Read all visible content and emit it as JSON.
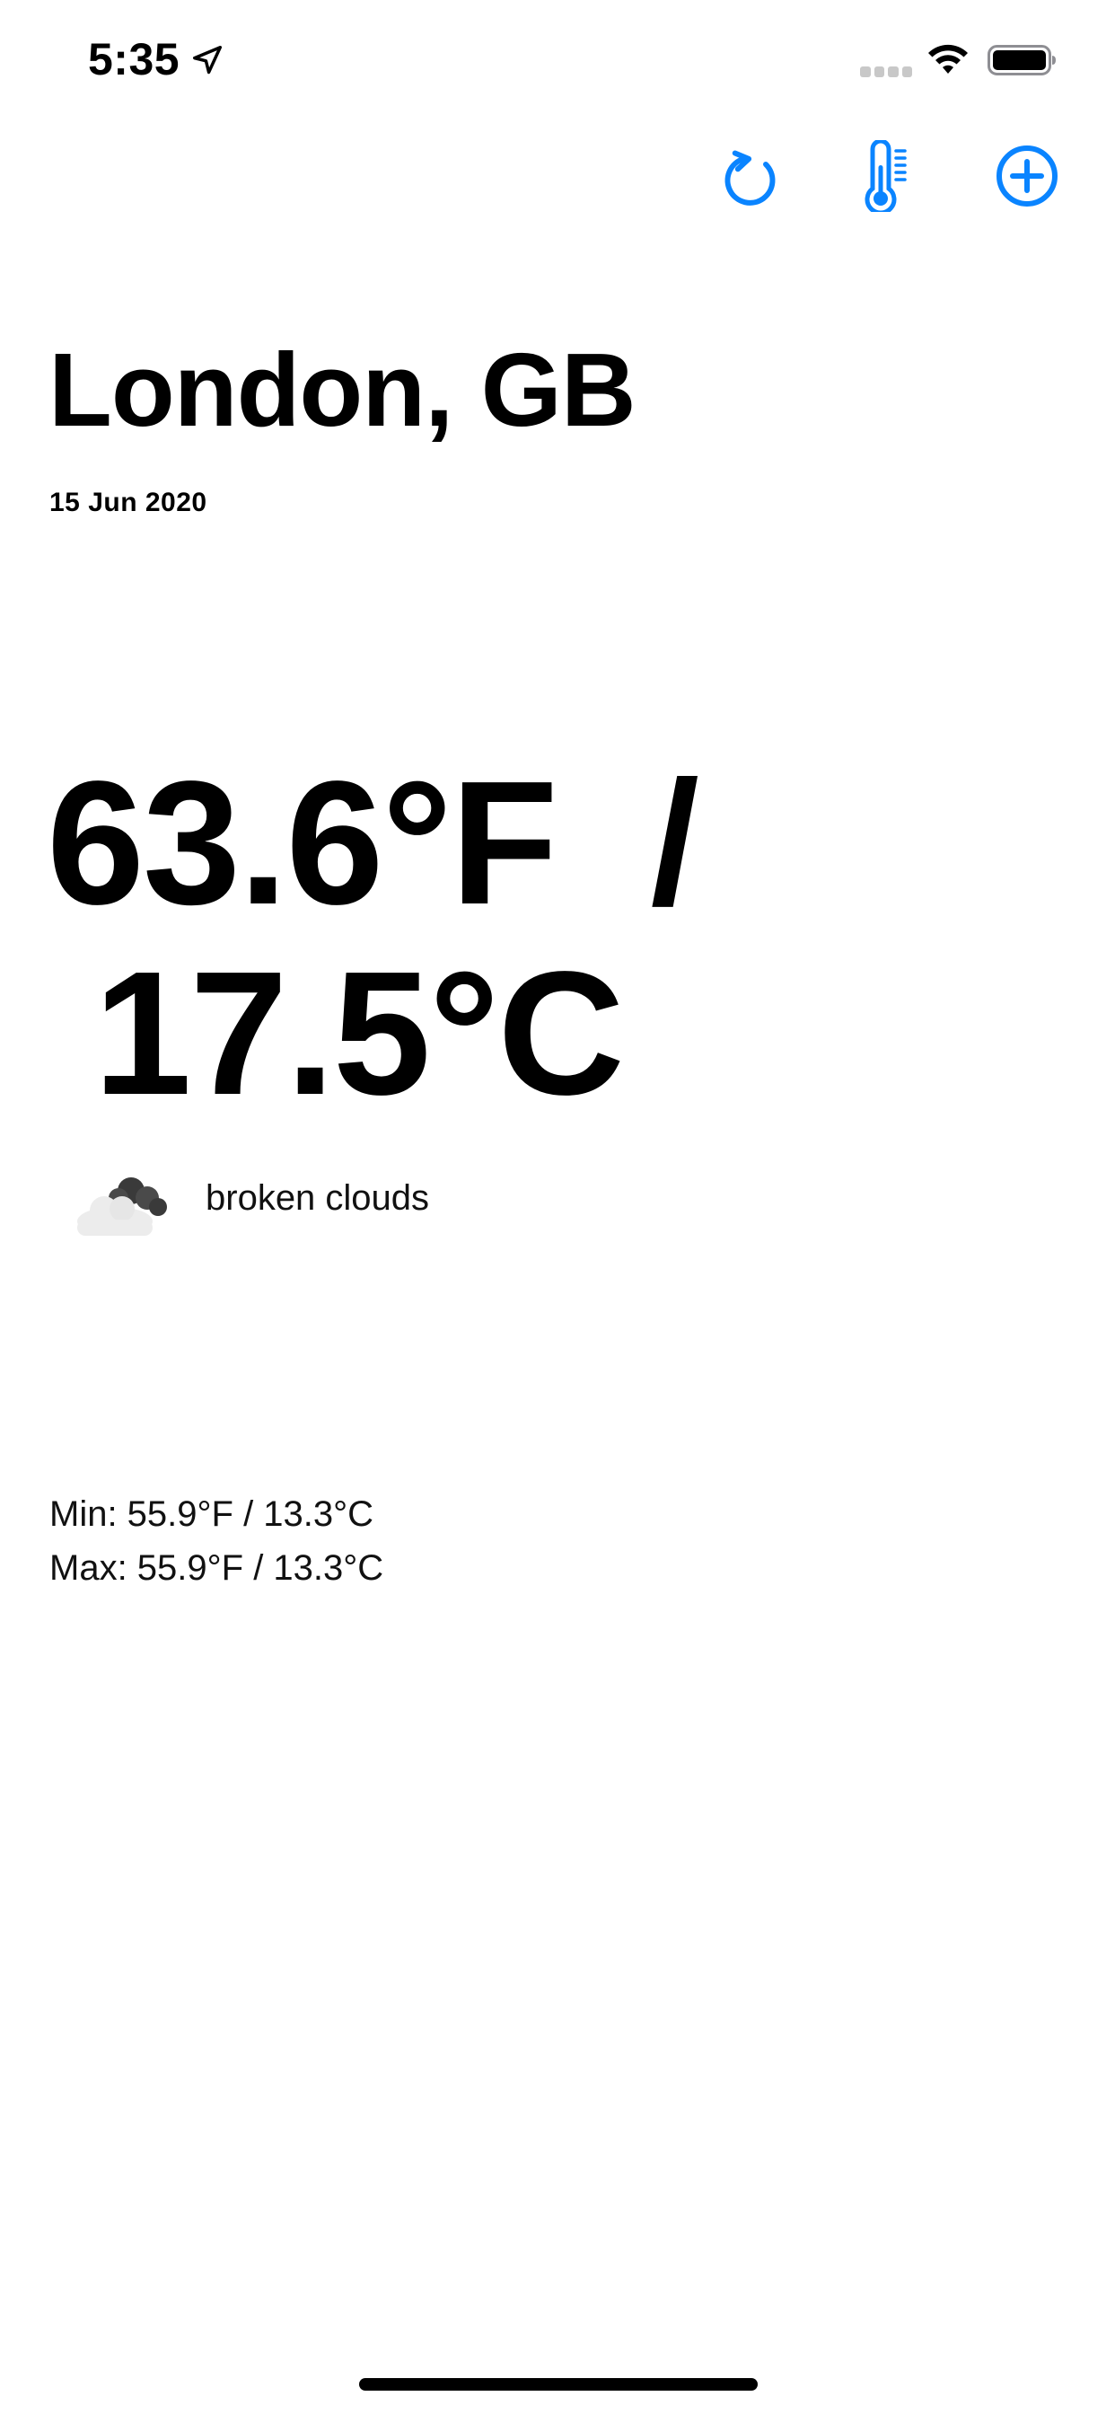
{
  "status_bar": {
    "time": "5:35",
    "icons": [
      "location-arrow-icon",
      "cellular-signal-icon",
      "wifi-icon",
      "battery-icon"
    ]
  },
  "toolbar": {
    "accent_color": "#0A84FF",
    "buttons": [
      {
        "icon": "refresh-icon"
      },
      {
        "icon": "thermometer-icon"
      },
      {
        "icon": "plus-circle-icon"
      }
    ]
  },
  "weather": {
    "city": "London, GB",
    "date": "15 Jun 2020",
    "temp_line_1": "63.6°F  /",
    "temp_line_2": " 17.5°C",
    "condition_icon": "broken-clouds-icon",
    "description": "broken clouds",
    "min": "Min: 55.9°F / 13.3°C",
    "max": "Max: 55.9°F / 13.3°C"
  }
}
